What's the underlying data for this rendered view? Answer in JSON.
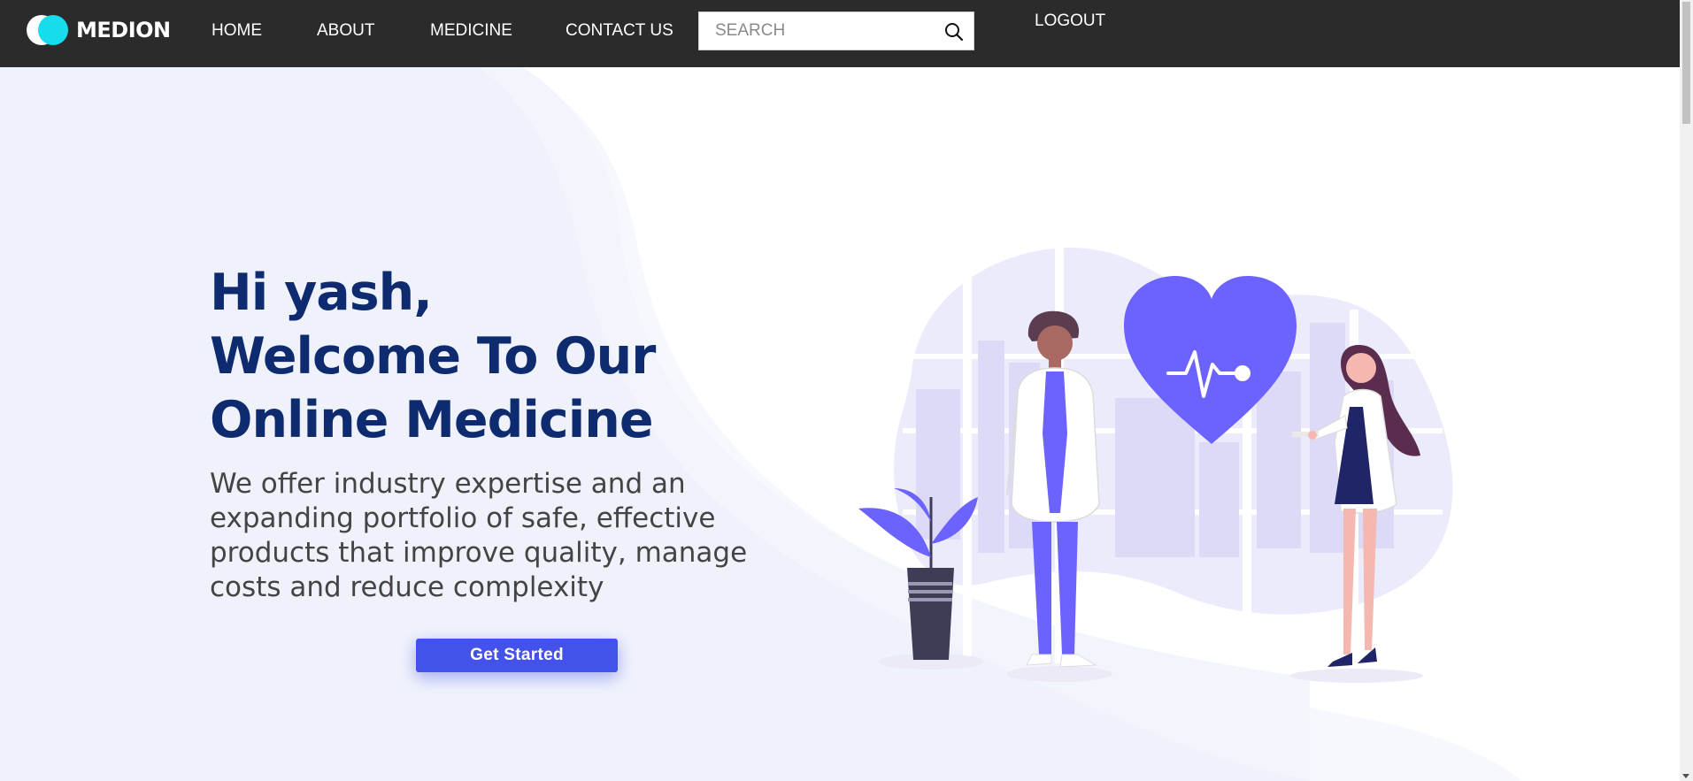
{
  "brand": {
    "name": "MEDION",
    "logo_icon": "two-circles-logo-icon"
  },
  "nav": {
    "links": [
      "HOME",
      "ABOUT",
      "MEDICINE",
      "CONTACT US"
    ],
    "search_placeholder": "SEARCH",
    "search_value": "",
    "logout_label": "LOGOUT"
  },
  "hero": {
    "greeting": "Hi yash,",
    "title_line1": "Welcome To Our",
    "title_line2": "Online Medicine",
    "description": "We offer industry expertise and an expanding portfolio of safe, effective products that improve quality, manage costs and reduce complexity",
    "cta_label": "Get Started"
  },
  "colors": {
    "navbar": "#2b2b2b",
    "accent": "#4452ec",
    "logo_cyan": "#16dcec",
    "heading": "#0d2b6e",
    "illustration_primary": "#6c63ff"
  },
  "icons": {
    "search": "search-icon",
    "heart": "heartbeat-heart-icon"
  }
}
